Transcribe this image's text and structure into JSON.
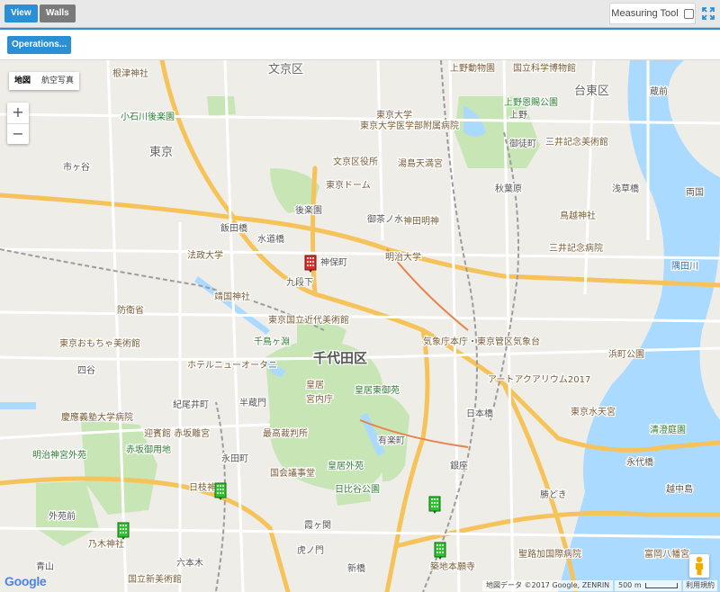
{
  "toolbar": {
    "view_label": "View",
    "walls_label": "Walls",
    "measuring_tool_label": "Measuring Tool"
  },
  "operations": {
    "button_label": "Operations..."
  },
  "map": {
    "map_type": {
      "map_label": "地図",
      "satellite_label": "航空写真"
    },
    "zoom": {
      "in_label": "+",
      "out_label": "−"
    },
    "labels": {
      "bunkyo": "文京区",
      "taito": "台東区",
      "chiyoda": "千代田区",
      "tokyo": "東京",
      "ueno_zoo": "上野動物園",
      "science_museum": "国立科学博物館",
      "ueno_park": "上野恩賜公園",
      "tokyo_univ": "東京大学",
      "univ_hospital": "東京大学医学部附属病院",
      "yushima": "湯島天満宮",
      "bunkyo_ward_office": "文京区役所",
      "tokyo_dome": "東京ドーム",
      "kanda_myojin": "神田明神",
      "meiji_univ": "明治大学",
      "juntendo": "順天堂大学",
      "yasukuni": "靖国神社",
      "hosei": "法政大学",
      "boueisho": "防衛省",
      "tokyo_toy_museum": "東京おもちゃ美術館",
      "kokuritsu_museum": "東京国立近代美術館",
      "kitanomaru": "北の丸公園",
      "chidorigafuchi": "千鳥ヶ淵",
      "kokyo": "皇居",
      "kokyo_higashi": "皇居東御苑",
      "kyunaicho": "宮内庁",
      "saikousai": "最高裁判所",
      "kokkai": "国会議事堂",
      "hibiya": "日比谷公園",
      "kokyo_gaien": "皇居外苑",
      "akasaka": "赤坂御用地",
      "meiji_jingu": "明治神宮外苑",
      "keio": "慶應義塾大学病院",
      "nogi": "乃木神社",
      "kokuritsu_shin": "国立新美術館",
      "hie": "日枝神社",
      "tokyo_station": "東京",
      "kisho": "気象庁本庁・東京管区気象台",
      "artaquarium": "アートアクアリウム2017",
      "hamacho": "浜町公園",
      "suitengu": "東京水天宮",
      "kiyosumi": "清澄庭園",
      "tsukiji": "築地本願寺",
      "seiroka": "聖路加国際病院",
      "hachiman": "富岡八幡宮",
      "torigoe": "鳥越神社",
      "mitsui": "三井記念病院",
      "sanmon": "三井記念美術館",
      "nezu": "根津神社",
      "kourakuen": "小石川後楽園",
      "yotsuya": "四谷",
      "akasaka_palace": "迎賓館 赤坂離宮",
      "kioi": "紀尾井町",
      "hotel": "ホテルニューオータニ",
      "shinjuku": "新宿御苑",
      "ichigaya": "市ヶ谷",
      "iidabashi": "飯田橋",
      "korakuen": "後楽園",
      "tokyo_univ_hongo": "東京大学本郷",
      "sumidagawa": "隅田川",
      "eitai": "永代橋",
      "nihonbashi": "日本橋",
      "ginza": "銀座",
      "yurakucho": "有楽町",
      "shimbashi": "新橋",
      "hamamatsucho": "浜松町",
      "kachidoki": "勝どき",
      "tsukishima": "月島",
      "etchujima": "越中島",
      "ryogoku": "両国",
      "kuramae": "蔵前",
      "asakusabashi": "浅草橋",
      "akihabara": "秋葉原",
      "okachimachi": "御徒町",
      "ueno": "上野",
      "suidobashi": "水道橋",
      "ochanomizu": "御茶ノ水",
      "jinbocho": "神保町",
      "kudanshita": "九段下",
      "hanzomon": "半蔵門",
      "nagatacho": "永田町",
      "kasumigaseki": "霞ヶ関",
      "toranomon": "虎ノ門",
      "roppongi": "六本木",
      "nishiazabu": "西麻布",
      "aoyama": "青山",
      "gaienmae": "外苑前"
    },
    "google_logo": "Google",
    "attribution": "地図データ ©2017 Google, ZENRIN",
    "scale_label": "500 m",
    "terms_label": "利用規約"
  },
  "markers": [
    {
      "id": "building-red",
      "status": "red",
      "color": "#d32f2f"
    },
    {
      "id": "building-green-1",
      "status": "green",
      "color": "#2ec22e"
    },
    {
      "id": "building-green-2",
      "status": "green",
      "color": "#2ec22e"
    },
    {
      "id": "building-green-3",
      "status": "green",
      "color": "#2ec22e"
    },
    {
      "id": "building-green-4",
      "status": "green",
      "color": "#2ec22e"
    }
  ]
}
